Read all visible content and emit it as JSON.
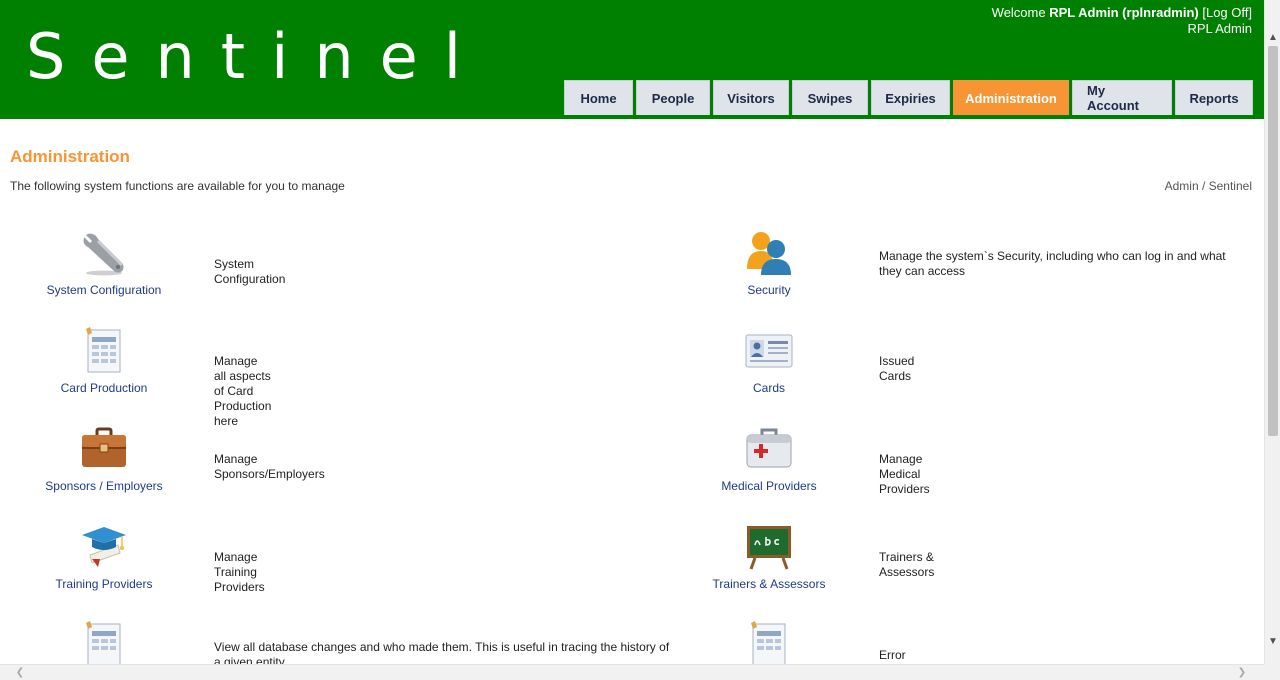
{
  "header": {
    "brand": "Sentinel",
    "welcome_prefix": "Welcome",
    "user_display": "RPL Admin (rplnradmin)",
    "logoff_label": "[Log Off]",
    "role": "RPL Admin"
  },
  "nav": {
    "tabs": [
      {
        "label": "Home",
        "active": false
      },
      {
        "label": "People",
        "active": false
      },
      {
        "label": "Visitors",
        "active": false
      },
      {
        "label": "Swipes",
        "active": false
      },
      {
        "label": "Expiries",
        "active": false
      },
      {
        "label": "Administration",
        "active": true
      },
      {
        "label": "My Account",
        "active": false
      },
      {
        "label": "Reports",
        "active": false
      }
    ]
  },
  "page": {
    "title": "Administration",
    "intro": "The following system functions are available for you to manage",
    "breadcrumb": "Admin / Sentinel"
  },
  "functions": {
    "left": [
      {
        "label": "System Configuration",
        "description": "System Configuration",
        "icon": "wrench-icon"
      },
      {
        "label": "Card Production",
        "description": "Manage all aspects of Card Production here",
        "icon": "document-table-icon"
      },
      {
        "label": "Sponsors / Employers",
        "description": "Manage Sponsors/Employers",
        "icon": "briefcase-icon"
      },
      {
        "label": "Training Providers",
        "description": "Manage Training Providers",
        "icon": "graduation-cap-icon"
      },
      {
        "label": "",
        "description": "View all database changes and who made them. This is useful in tracing the history of a given entity",
        "icon": "document-table-icon"
      }
    ],
    "right": [
      {
        "label": "Security",
        "description": "Manage the system`s Security, including who can log in and what they can access",
        "icon": "users-icon"
      },
      {
        "label": "Cards",
        "description": "Issued Cards",
        "icon": "id-card-icon"
      },
      {
        "label": "Medical Providers",
        "description": "Manage Medical Providers",
        "icon": "first-aid-kit-icon"
      },
      {
        "label": "Trainers & Assessors",
        "description": "Trainers & Assessors",
        "icon": "chalkboard-icon"
      },
      {
        "label": "",
        "description": "Error Logs",
        "icon": "document-table-icon"
      }
    ]
  },
  "colors": {
    "header_green": "#008000",
    "accent_orange": "#f79433",
    "link_blue": "#1e3a8a"
  }
}
